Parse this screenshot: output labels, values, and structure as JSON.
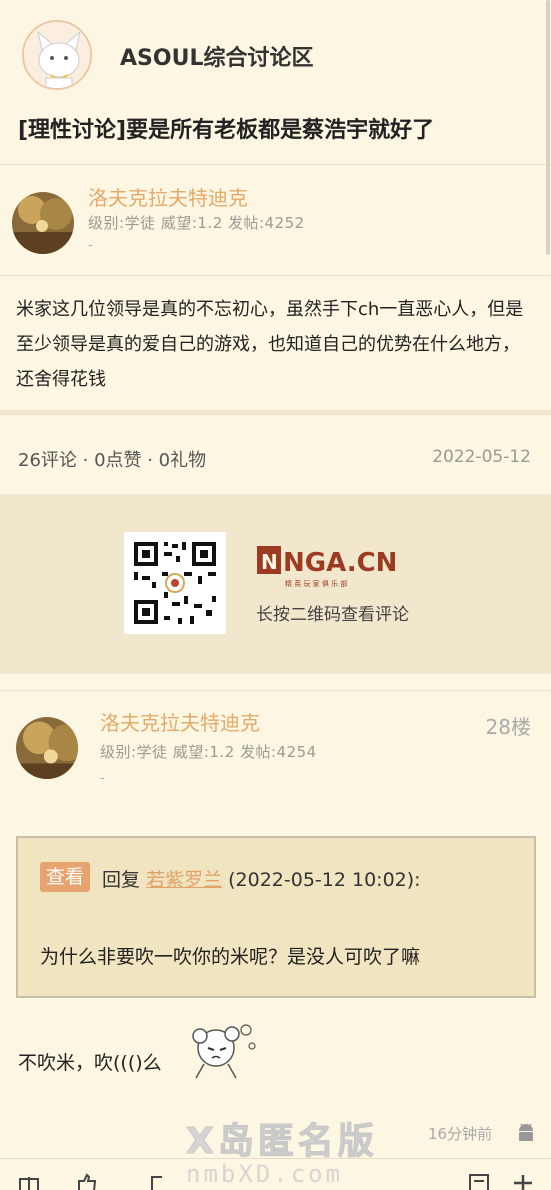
{
  "forum": {
    "name": "ASOUL综合讨论区",
    "avatar_icon": "cat-mascot-avatar"
  },
  "thread": {
    "title": "[理性讨论]要是所有老板都是蔡浩宇就好了"
  },
  "op": {
    "name": "洛夫克拉夫特迪克",
    "meta": "级别:学徒 威望:1.2 发帖:4252",
    "dash": "-",
    "body": "米家这几位领导是真的不忘初心，虽然手下ch一直恶心人，但是至少领导是真的爱自己的游戏，也知道自己的优势在什么地方，还舍得花钱"
  },
  "stats": {
    "text": "26评论 · 0点赞 · 0礼物",
    "date": "2022-05-12"
  },
  "qr": {
    "logo": "NGA.CN",
    "logo_sub": "精 英 玩 家 俱 乐 部",
    "hint": "长按二维码查看评论"
  },
  "reply": {
    "name": "洛夫克拉夫特迪克",
    "floor": "28楼",
    "meta": "级别:学徒 威望:1.2 发帖:4254",
    "dash": "-",
    "quote": {
      "tag": "查看",
      "prefix": "回复",
      "user": "若紫罗兰",
      "time": "(2022-05-12 10:02):",
      "text": "为什么非要吹一吹你的米呢？是没人可吹了嘛"
    },
    "text": "不吹米，吹((()么",
    "time_ago": "16分钟前"
  },
  "watermark": {
    "line1": "X岛匿名版",
    "line2": "nmbXD.com"
  },
  "colors": {
    "background": "#fdf6e2",
    "accent": "#e5a96a",
    "quote_bg": "#f1e4c0",
    "tag": "#e8a46e"
  }
}
